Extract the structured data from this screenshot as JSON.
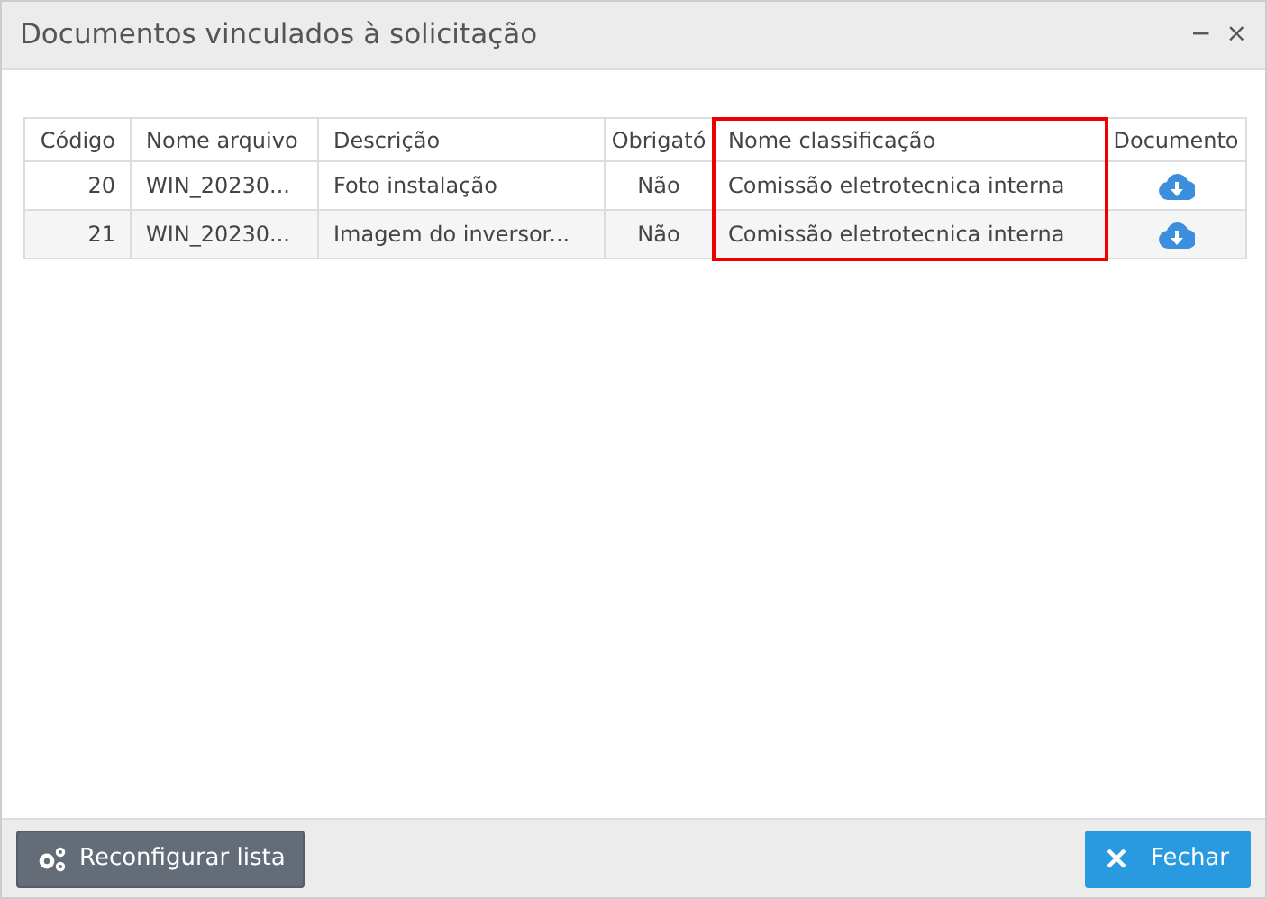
{
  "window": {
    "title": "Documentos vinculados à solicitação",
    "controls": [
      "−",
      "×"
    ]
  },
  "table": {
    "columns": [
      {
        "label": "Código",
        "kind": "number",
        "highlighted": false
      },
      {
        "label": "Nome arquivo",
        "kind": "text",
        "highlighted": false
      },
      {
        "label": "Descrição",
        "kind": "text",
        "highlighted": false
      },
      {
        "label": "Obrigató",
        "kind": "flag",
        "highlighted": false
      },
      {
        "label": "Nome classificação",
        "kind": "text",
        "highlighted": true
      },
      {
        "label": "Documento",
        "kind": "file",
        "highlighted": false
      }
    ],
    "rows": [
      {
        "cells": [
          "20",
          "WIN_20230...",
          "Foto instalação",
          "Não",
          "Comissão eletrotecnica interna"
        ]
      },
      {
        "cells": [
          "21",
          "WIN_20230...",
          "Imagem do inversor...",
          "Não",
          "Comissão eletrotecnica interna"
        ]
      }
    ]
  },
  "footer": {
    "buttons": [
      {
        "label": "Reconfigurar lista",
        "kind": "settings"
      },
      {
        "label": "Fechar",
        "kind": "close"
      }
    ]
  }
}
